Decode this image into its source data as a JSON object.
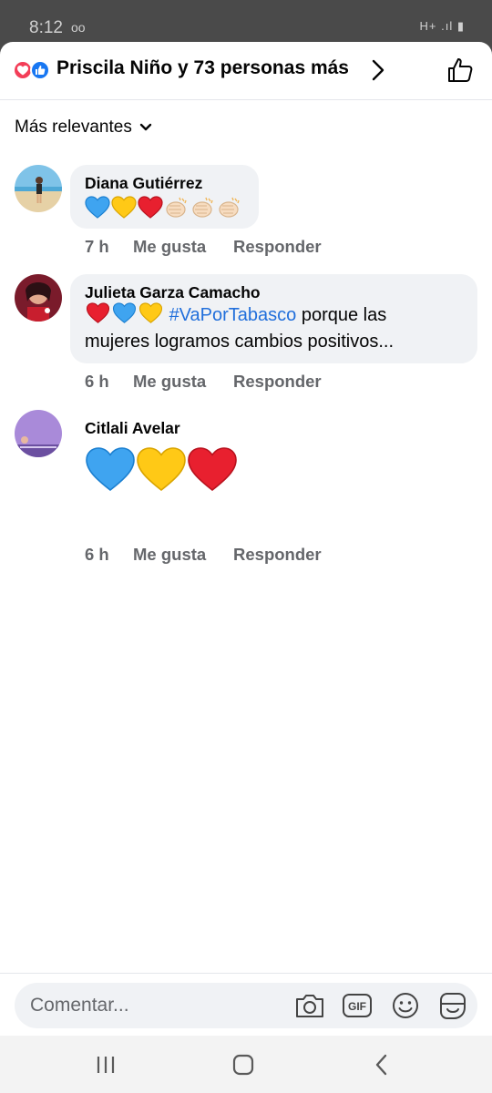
{
  "status_bar": {
    "time": "8:12",
    "voicemail": "oo",
    "signal": "H+ .ıl ▮"
  },
  "header": {
    "title": "Priscila Niño y 73 personas más",
    "reactions": [
      "love-reaction-icon",
      "like-reaction-icon"
    ]
  },
  "sort": {
    "label": "Más relevantes"
  },
  "comments": [
    {
      "author": "Diana Gutiérrez",
      "emojis": [
        "blue-heart",
        "yellow-heart",
        "red-heart",
        "clap",
        "clap",
        "clap"
      ],
      "time": "7 h",
      "like_label": "Me gusta",
      "reply_label": "Responder"
    },
    {
      "author": "Julieta Garza Camacho",
      "emojis": [
        "red-heart",
        "blue-heart",
        "yellow-heart"
      ],
      "hashtag": "#VaPorTabasco",
      "text_after_hashtag": " porque las",
      "text_line2": "mujeres logramos cambios positivos...",
      "time": "6 h",
      "like_label": "Me gusta",
      "reply_label": "Responder"
    },
    {
      "author": "Citlali Avelar",
      "emojis": [
        "blue-heart",
        "yellow-heart",
        "red-heart"
      ],
      "time": "6 h",
      "like_label": "Me gusta",
      "reply_label": "Responder"
    }
  ],
  "composer": {
    "placeholder": "Comentar...",
    "icons": [
      "camera-icon",
      "gif-icon",
      "smiley-icon",
      "sticker-icon"
    ],
    "gif_label": "GIF"
  },
  "colors": {
    "accent": "#1877f2",
    "hashtag": "#216fdb",
    "love": "#f33e58",
    "bubble": "#f0f2f5",
    "secondary_text": "#65676b"
  }
}
